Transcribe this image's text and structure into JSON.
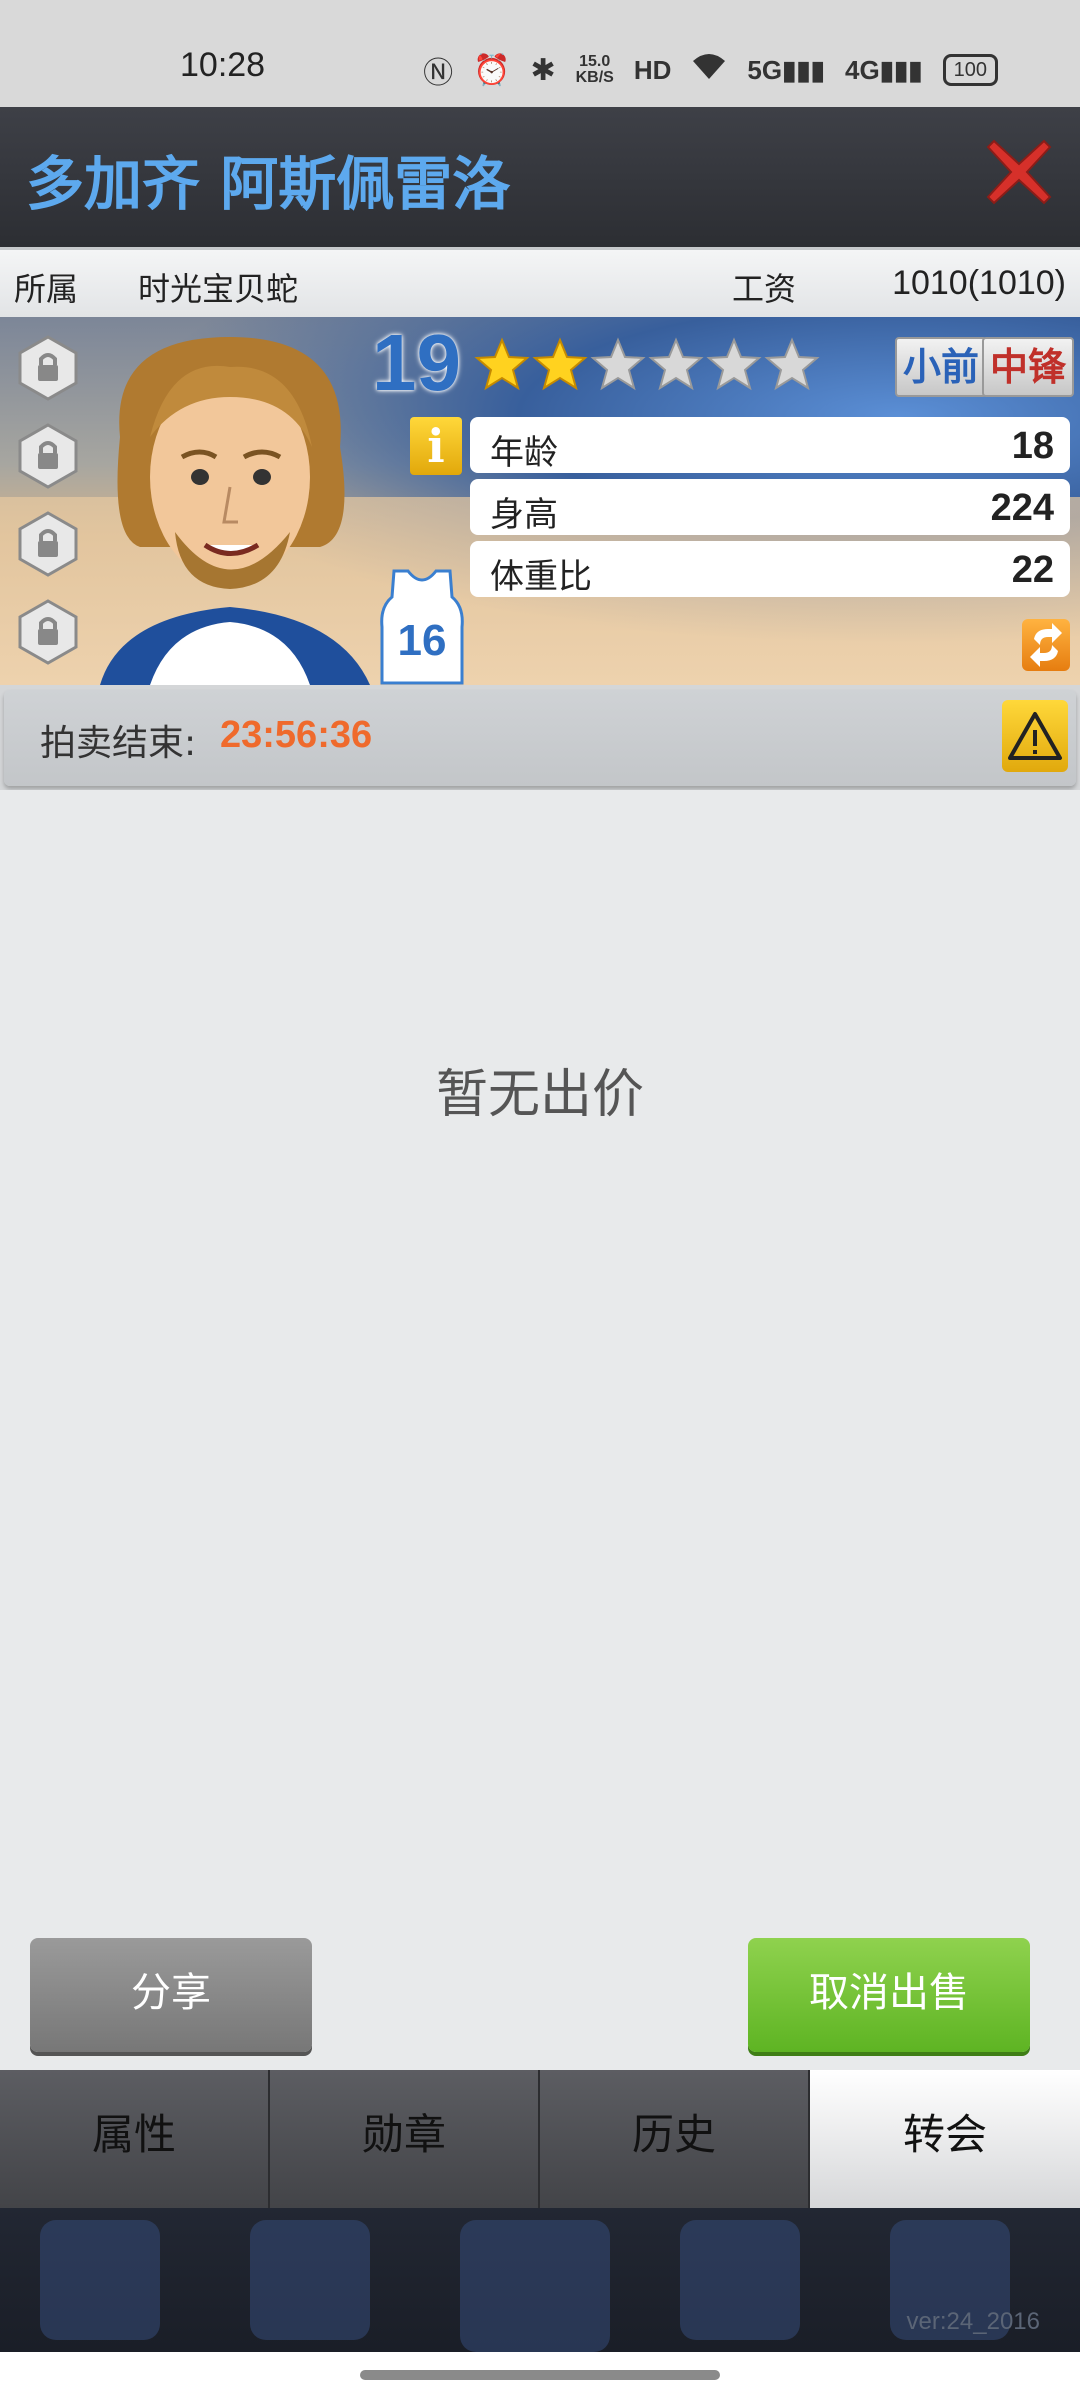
{
  "status_bar": {
    "time": "10:28",
    "net_speed_value": "15.0",
    "net_speed_unit": "KB/S",
    "hd_label": "HD",
    "net1": "5G",
    "net2": "4G",
    "battery": "100"
  },
  "header": {
    "title": "多加齐 阿斯佩雷洛"
  },
  "info_row": {
    "team_label": "所属",
    "team_value": "时光宝贝蛇",
    "salary_label": "工资",
    "salary_value": "1010(1010)"
  },
  "player": {
    "level": "19",
    "stars_filled": 2,
    "stars_total": 6,
    "jersey_number": "16",
    "positions": [
      "小前",
      "中锋"
    ],
    "info_icon": "i",
    "stats": [
      {
        "label": "年龄",
        "value": "18"
      },
      {
        "label": "身高",
        "value": "224"
      },
      {
        "label": "体重比",
        "value": "22"
      }
    ]
  },
  "auction": {
    "label": "拍卖结束:",
    "countdown": "23:56:36"
  },
  "content": {
    "empty_text": "暂无出价"
  },
  "buttons": {
    "share": "分享",
    "cancel_sale": "取消出售"
  },
  "tabs": [
    {
      "label": "属性",
      "active": false
    },
    {
      "label": "勋章",
      "active": false
    },
    {
      "label": "历史",
      "active": false
    },
    {
      "label": "转会",
      "active": true
    }
  ],
  "footer": {
    "version": "ver:24_2016"
  },
  "colors": {
    "title": "#5da9ee",
    "countdown": "#ef6a2c",
    "cancel_button": "#6cc02f",
    "share_button": "#888888",
    "close": "#d6302a"
  }
}
